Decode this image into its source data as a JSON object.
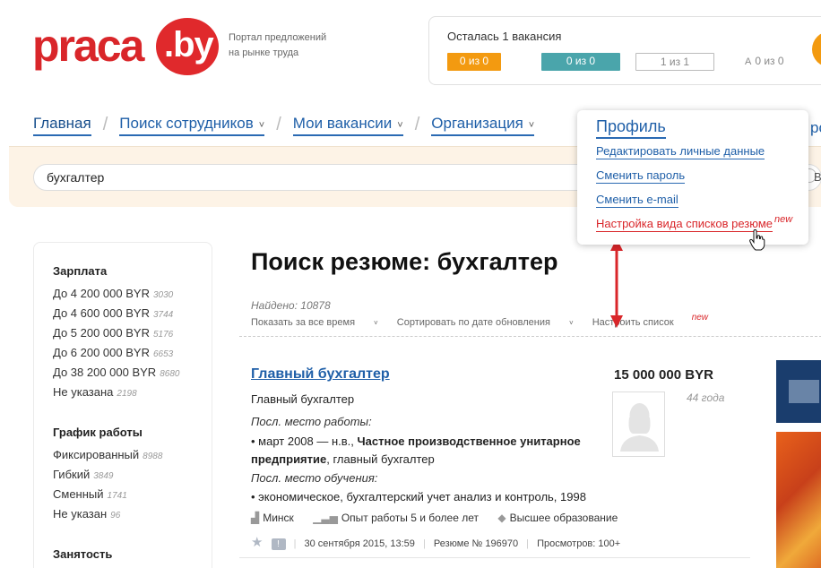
{
  "header": {
    "logo_word": "praca",
    "logo_suffix": ".by",
    "tagline": "Портал предложений на рынке труда",
    "vacancies": {
      "title": "Осталась 1 вакансия",
      "btn1": "0 из 0",
      "btn2": "0 из 0",
      "btn3": "1 из 1",
      "btn4_icon": "A",
      "btn4": "0 из 0"
    }
  },
  "nav": {
    "items": [
      {
        "label": "Главная"
      },
      {
        "label": "Поиск сотрудников",
        "chevron": "˅"
      },
      {
        "label": "Мои вакансии",
        "chevron": "˅"
      },
      {
        "label": "Организация",
        "chevron": "˅"
      }
    ],
    "edge_text": "ро"
  },
  "search": {
    "value": "бухгалтер",
    "edge_label": "В"
  },
  "dropdown": {
    "title": "Профиль",
    "items": [
      "Редактировать личные данные",
      "Сменить пароль",
      "Сменить e-mail",
      "Настройка вида списков резюме"
    ],
    "new_badge": "new"
  },
  "sidebar": {
    "salary_title": "Зарплата",
    "salary": [
      {
        "label": "До 4 200 000 BYR",
        "count": "3030"
      },
      {
        "label": "До 4 600 000 BYR",
        "count": "3744"
      },
      {
        "label": "До 5 200 000 BYR",
        "count": "5176"
      },
      {
        "label": "До 6 200 000 BYR",
        "count": "6653"
      },
      {
        "label": "До 38 200 000 BYR",
        "count": "8680"
      },
      {
        "label": "Не указана",
        "count": "2198"
      }
    ],
    "schedule_title": "График работы",
    "schedule": [
      {
        "label": "Фиксированный",
        "count": "8988"
      },
      {
        "label": "Гибкий",
        "count": "3849"
      },
      {
        "label": "Сменный",
        "count": "1741"
      },
      {
        "label": "Не указан",
        "count": "96"
      }
    ],
    "employment_title": "Занятость"
  },
  "main": {
    "title": "Поиск резюме: бухгалтер",
    "found": "Найдено: 10878",
    "filters": {
      "time": "Показать за все время",
      "sort": "Сортировать по дате обновления",
      "configure": "Настроить список",
      "new_badge": "new"
    },
    "resume": {
      "title": "Главный бухгалтер",
      "salary": "15 000 000 BYR",
      "age": "44 года",
      "position": "Главный бухгалтер",
      "last_work_label": "Посл. место работы:",
      "last_work_prefix": "• март 2008 — н.в.,",
      "last_work_org": "Частное производственное унитарное предприятие",
      "last_work_suffix": ", главный бухгалтер",
      "last_study_label": "Посл. место обучения:",
      "last_study": "• экономическое, бухгалтерский учет анализ и контроль, 1998",
      "city": "Минск",
      "experience": "Опыт работы 5 и более лет",
      "education": "Высшее образование",
      "date": "30 сентября 2015, 13:59",
      "number": "Резюме № 196970",
      "views": "Просмотров: 100+"
    }
  },
  "colors": {
    "brand_red": "#d9262a",
    "link_blue": "#1f5fa8",
    "orange": "#f39a10",
    "teal": "#4aa5ab",
    "search_band": "#fdf3e6"
  }
}
